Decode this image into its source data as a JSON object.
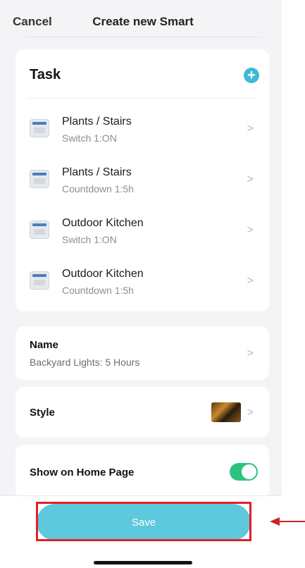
{
  "header": {
    "cancel_label": "Cancel",
    "title": "Create new Smart"
  },
  "task": {
    "heading": "Task",
    "add_icon": "plus-circle-icon",
    "items": [
      {
        "name": "Plants / Stairs",
        "status": "Switch 1:ON"
      },
      {
        "name": "Plants / Stairs",
        "status": "Countdown 1:5h"
      },
      {
        "name": "Outdoor Kitchen",
        "status": "Switch 1:ON"
      },
      {
        "name": "Outdoor Kitchen",
        "status": "Countdown 1:5h"
      }
    ]
  },
  "name_section": {
    "label": "Name",
    "value": "Backyard Lights: 5 Hours"
  },
  "style_section": {
    "label": "Style"
  },
  "home_section": {
    "label": "Show on Home Page",
    "toggle_on": true
  },
  "save_label": "Save",
  "colors": {
    "accent": "#3fb8d6",
    "save_button": "#5ec8dc",
    "toggle_on": "#2ec27e",
    "highlight": "#e0202a"
  }
}
